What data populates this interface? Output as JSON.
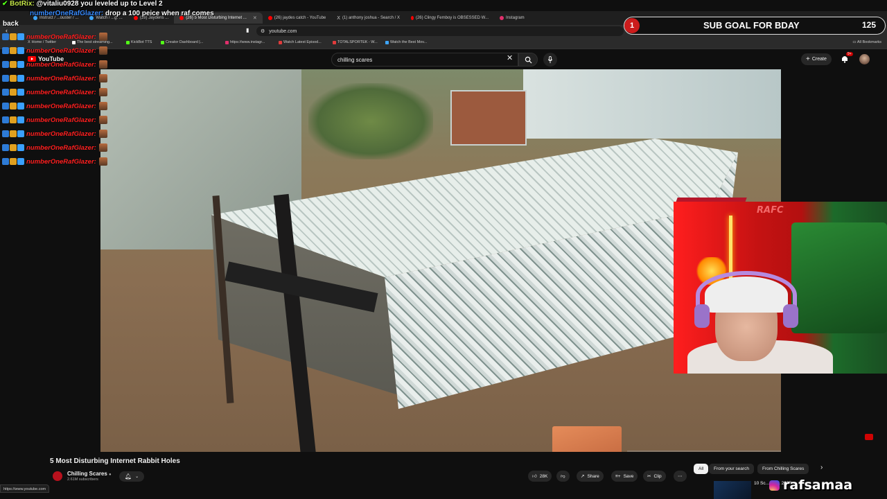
{
  "browser": {
    "tabs": [
      {
        "label": "Instruct / ...ouster / ...",
        "color": "#3ea6ff"
      },
      {
        "label": "Watch / ...g: ...",
        "color": "#3ea6ff"
      },
      {
        "label": "(26) Jaydens ...",
        "color": "#ff0000"
      },
      {
        "label": "(26) 5 Most Disturbing Internet ...",
        "color": "#ff0000",
        "active": true
      },
      {
        "label": "(26) jaydes catch - YouTube",
        "color": "#ff0000"
      },
      {
        "label": "(1) anthony joshua - Search / X",
        "color": "#ffffff"
      },
      {
        "label": "(26) Clingy Femboy is OBSESSED W...",
        "color": "#ff0000"
      },
      {
        "label": "Instagram",
        "color": "#e1306c"
      }
    ],
    "url": "youtube.com",
    "bookmarks": [
      {
        "label": "Home / Twitter",
        "color": "#ffffff"
      },
      {
        "label": "The best streaming...",
        "color": "#ffffff"
      },
      {
        "label": "KickBot TTS",
        "color": "#53fc18"
      },
      {
        "label": "Creator Dashboard |...",
        "color": "#53fc18"
      },
      {
        "label": "https://www.instagr...",
        "color": "#e1306c"
      },
      {
        "label": "Watch Latest Episod...",
        "color": "#e03b3b"
      },
      {
        "label": "TOTALSPORTEK - W...",
        "color": "#e03b3b"
      },
      {
        "label": "Watch the Best Mov...",
        "color": "#3ea6ff"
      }
    ],
    "all_bookmarks": "All Bookmarks",
    "status_url": "https://www.youtube.com"
  },
  "youtube": {
    "logo": "YouTube",
    "search_query": "chilling scares",
    "create_label": "Create",
    "notif_count": "9+",
    "video_title": "5 Most Disturbing Internet Rabbit Holes",
    "channel_name": "Chilling Scares",
    "channel_subs": "2.61M subscribers",
    "like_count": "28K",
    "share_label": "Share",
    "save_label": "Save",
    "clip_label": "Clip",
    "chips": [
      "All",
      "From your search",
      "From Chilling Scares"
    ],
    "next_video_text": "10 Sc... TR... 2025"
  },
  "overlay": {
    "chat_top_name": "BotRix:",
    "chat_top_text": "@vitaliu0928 you leveled up to Level 2",
    "chat2_name": "numberOneRafGlazer:",
    "chat2_text": "drop a 100 peice when raf comes",
    "chat_back": "back",
    "chat_repeat_name": "numberOneRafGlazer:",
    "subgoal_bubble": "1",
    "subgoal_label": "SUB GOAL FOR BDAY",
    "subgoal_count": "125",
    "watermark": "rafsamaa",
    "webcam_logo": "RAFC"
  }
}
